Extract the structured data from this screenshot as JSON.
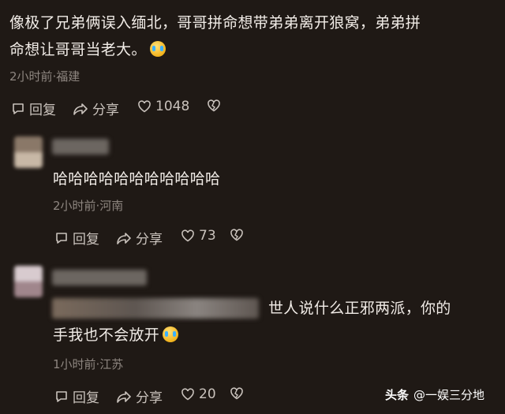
{
  "comments": [
    {
      "text_line1": "像极了兄弟俩误入缅北，哥哥拼命想带弟弟离开狼窝，弟弟拼",
      "text_line2": "命想让哥哥当老大。",
      "emoji": "crying-emoji",
      "meta": "2小时前·福建",
      "reply_label": "回复",
      "share_label": "分享",
      "likes": "1048"
    },
    {
      "text": "哈哈哈哈哈哈哈哈哈哈哈",
      "meta": "2小时前·河南",
      "reply_label": "回复",
      "share_label": "分享",
      "likes": "73"
    },
    {
      "text_line1": "世人说什么正邪两派，你的",
      "text_line2": "手我也不会放开",
      "emoji": "crying-emoji",
      "meta": "1小时前·江苏",
      "reply_label": "回复",
      "share_label": "分享",
      "likes": "20"
    }
  ],
  "watermark": {
    "brand": "头条",
    "author": "@一娱三分地"
  },
  "colors": {
    "background": "#1f1915",
    "text": "#f1ece7",
    "meta": "#8e8680"
  }
}
